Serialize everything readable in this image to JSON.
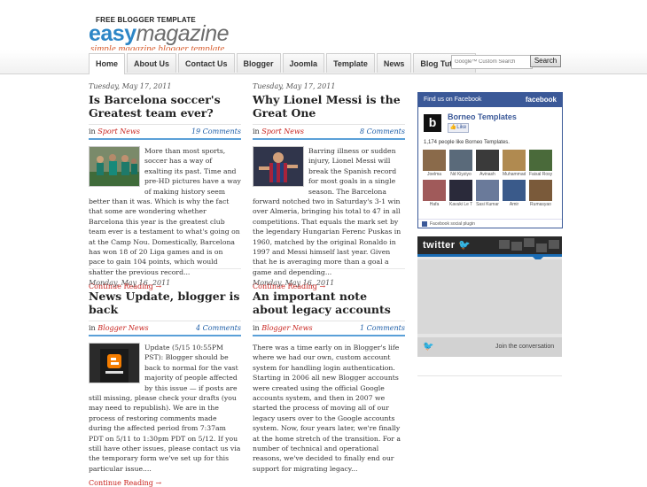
{
  "header": {
    "top_line": "FREE BLOGGER TEMPLATE",
    "logo_easy": "easy",
    "logo_magazine": "magazine",
    "tagline": "simple magazine blogger template"
  },
  "nav": {
    "items": [
      "Home",
      "About Us",
      "Contact Us",
      "Blogger",
      "Joomla",
      "Template",
      "News",
      "Blog Tutorial"
    ],
    "active": "Home"
  },
  "search": {
    "placeholder": "Google™ Custom Search",
    "button_label": "Search"
  },
  "posts": [
    {
      "date": "Tuesday, May 17, 2011",
      "title": "Is Barcelona soccer's Greatest team ever?",
      "in_label": "in",
      "category": "Sport News",
      "comments": "19 Comments",
      "body": "More than most sports, soccer has a way of exalting its past. Time and pre-HD pictures have a way of making history seem better than it was. Which is why the fact that some are wondering whether Barcelona this year is the greatest club team ever is a testament to what's going on at the Camp Nou. Domestically, Barcelona has won 18 of 20 Liga games and is on pace to gain 104 points, which would shatter the previous record...",
      "continue": "Continue Reading →"
    },
    {
      "date": "Tuesday, May 17, 2011",
      "title": "Why Lionel Messi is the Great One",
      "in_label": "in",
      "category": "Sport News",
      "comments": "8 Comments",
      "body": "Barring illness or sudden injury, Lionel Messi will break the Spanish record for most goals in a single season. The Barcelona forward notched two in Saturday's 3-1 win over Almeria, bringing his total to 47 in all competitions. That equals the mark set by the legendary Hungarian Ferenc Puskas in 1960, matched by the original Ronaldo in 1997 and Messi himself last year. Given that he is averaging more than a goal a game and depending...",
      "continue": "Continue Reading →"
    },
    {
      "date": "Monday, May 16, 2011",
      "title": "News Update, blogger is back",
      "in_label": "in",
      "category": "Blogger News",
      "comments": "4 Comments",
      "body": "Update (5/15 10:55PM PST): Blogger should be back to normal for the vast majority of people affected by this issue — if posts are still missing, please check your drafts (you may need to republish). We are in the process of restoring comments made during the affected period from 7:37am PDT on 5/11 to 1:30pm PDT on 5/12. If you still have other issues, please contact us via the temporary form we've set up for this particular issue....",
      "continue": "Continue Reading →"
    },
    {
      "date": "Monday, May 16, 2011",
      "title": "An important note about legacy accounts",
      "in_label": "in",
      "category": "Blogger News",
      "comments": "1 Comments",
      "body": "There was a time early on in Blogger's life where we had our own, custom account system for handling login authentication. Starting in 2006 all new Blogger accounts were created using the official Google accounts system, and then in 2007 we started the process of moving all of our legacy users over to the Google accounts system. Now, four years later, we're finally at the home stretch of the transition. For a number of technical and operational reasons, we've decided to finally end our support for migrating legacy...",
      "continue": ""
    }
  ],
  "facebook": {
    "header": "Find us on Facebook",
    "brand": "facebook",
    "page_initial": "b",
    "page_name": "Borneo Templates",
    "like_label": "Like",
    "count_text": "1,174 people like Borneo Templates.",
    "faces": [
      "Joelma",
      "Nd Kiyziyo",
      "Avinash",
      "Muhammad",
      "Faisal Rosyi",
      "Hafa",
      "Kavuki Le Tr",
      "Sasi Kumar",
      "Amir",
      "Rumasyao"
    ],
    "face_colors": [
      "#8a6a4a",
      "#5a6a7a",
      "#3a3a3a",
      "#b08a50",
      "#4a6a3a",
      "#a05a5a",
      "#2a2a3a",
      "#6a7a9a",
      "#3a5a8a",
      "#7a5a3a"
    ],
    "footer": "Facebook social plugin"
  },
  "twitter": {
    "brand": "twitter",
    "join": "Join the conversation"
  }
}
